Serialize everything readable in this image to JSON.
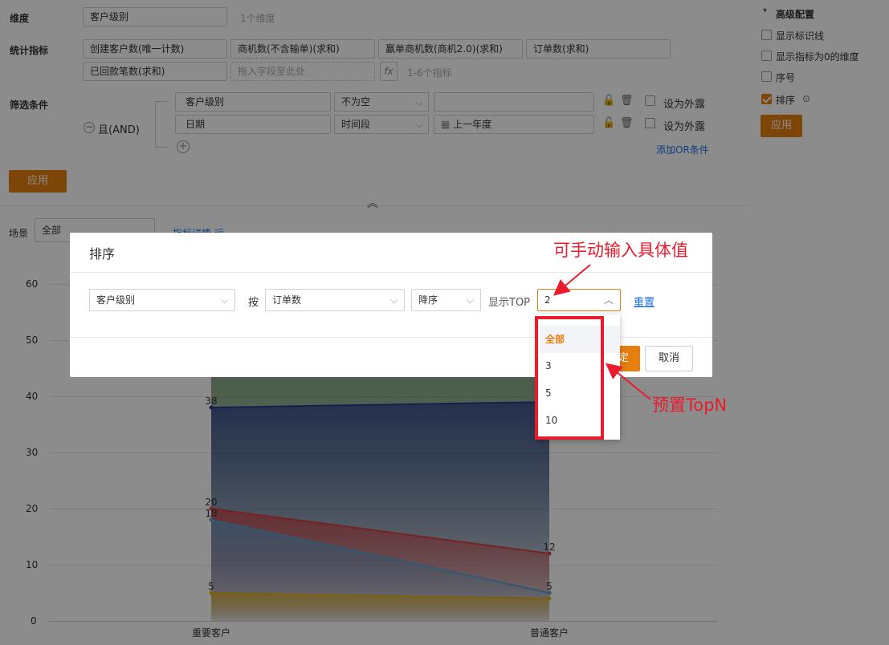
{
  "config": {
    "dimension_label": "维度",
    "dimension_value": "客户级别",
    "dimension_hint": "1个维度",
    "metrics_label": "统计指标",
    "metrics": [
      "创建客户数(唯一计数)",
      "商机数(不含输单)(求和)",
      "赢单商机数(商机2.0)(求和)",
      "订单数(求和)",
      "已回款笔数(求和)"
    ],
    "metrics_drop_placeholder": "拖入字段至此处",
    "metrics_fx": "fx",
    "metrics_hint": "1-6个指标",
    "filter_label": "筛选条件",
    "filter_logic": "且(AND)",
    "filters": [
      {
        "field": "客户级别",
        "op": "不为空",
        "value": "",
        "expose_label": "设为外露"
      },
      {
        "field": "日期",
        "op": "时间段",
        "value": "上一年度",
        "expose_label": "设为外露"
      }
    ],
    "add_or": "添加OR条件",
    "apply_label": "应用"
  },
  "sidebar": {
    "title": "高级配置",
    "options": [
      {
        "label": "显示标识线",
        "checked": false
      },
      {
        "label": "显示指标为0的维度",
        "checked": false
      },
      {
        "label": "序号",
        "checked": false
      },
      {
        "label": "排序",
        "checked": true
      }
    ],
    "apply_label": "应用"
  },
  "scene": {
    "label": "场景",
    "value": "全部",
    "link": "指标详情 运"
  },
  "modal": {
    "title": "排序",
    "dimension": "客户级别",
    "by_label": "按",
    "metric": "订单数",
    "order": "降序",
    "top_label": "显示TOP",
    "top_value": "2",
    "reset_label": "重置",
    "confirm_partial": "定",
    "cancel_label": "取消"
  },
  "dropdown": {
    "options": [
      "全部",
      "3",
      "5",
      "10"
    ],
    "highlighted": "全部"
  },
  "annotations": {
    "manual_input": "可手动输入具体值",
    "preset_topn": "预置TopN"
  },
  "chart_data": {
    "type": "area",
    "categories": [
      "重要客户",
      "普通客户"
    ],
    "ylim": [
      0,
      60
    ],
    "yticks": [
      0,
      10,
      20,
      30,
      40,
      50,
      60
    ],
    "series": [
      {
        "color": "#4a7a4a",
        "values": [
          50,
          50
        ]
      },
      {
        "color": "#2a3a8a",
        "values": [
          38,
          39
        ]
      },
      {
        "color": "#d04040",
        "values": [
          20,
          12
        ]
      },
      {
        "color": "#5aa0d0",
        "values": [
          18,
          5
        ]
      },
      {
        "color": "#e0b020",
        "values": [
          5,
          4
        ]
      }
    ],
    "data_labels": [
      {
        "text": "38",
        "category": 0,
        "value": 38
      },
      {
        "text": "20",
        "category": 0,
        "value": 20
      },
      {
        "text": "18",
        "category": 0,
        "value": 18
      },
      {
        "text": "5",
        "category": 0,
        "value": 5
      },
      {
        "text": "12",
        "category": 1,
        "value": 12
      },
      {
        "text": "5",
        "category": 1,
        "value": 5
      }
    ]
  }
}
